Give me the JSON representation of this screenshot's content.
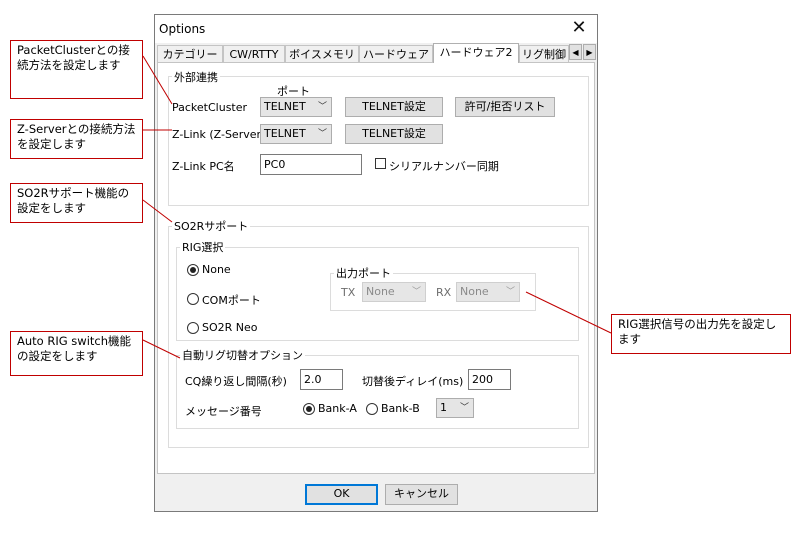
{
  "dialog": {
    "title": "Options",
    "close_glyph": "✕",
    "tabs": [
      "カテゴリー",
      "CW/RTTY",
      "ボイスメモリ",
      "ハードウェア",
      "ハードウェア2",
      "リグ制御"
    ],
    "active_tab": "ハードウェア2",
    "tab_scroll_left": "◀",
    "tab_scroll_right": "▶"
  },
  "external": {
    "group_label": "外部連携",
    "port_header": "ポート",
    "packet_label": "PacketCluster",
    "packet_port": "TELNET",
    "packet_telnet_btn": "TELNET設定",
    "packet_list_btn": "許可/拒否リスト",
    "zlink_label": "Z-Link (Z-Server",
    "zlink_port": "TELNET",
    "zlink_telnet_btn": "TELNET設定",
    "pcname_label": "Z-Link PC名",
    "pcname_value": "PC0",
    "serial_sync_label": "シリアルナンバー同期"
  },
  "so2r": {
    "group_label": "SO2Rサポート",
    "rig_group_label": "RIG選択",
    "options": [
      "None",
      "COMポート",
      "SO2R Neo"
    ],
    "output_port_label": "出力ポート",
    "tx_label": "TX",
    "tx_value": "None",
    "rx_label": "RX",
    "rx_value": "None"
  },
  "autorig": {
    "group_label": "自動リグ切替オプション",
    "cq_interval_label": "CQ繰り返し間隔(秒)",
    "cq_interval_value": "2.0",
    "delay_label": "切替後ディレイ(ms)",
    "delay_value": "200",
    "message_label": "メッセージ番号",
    "bank_a": "Bank-A",
    "bank_b": "Bank-B",
    "message_number": "1"
  },
  "footer": {
    "ok": "OK",
    "cancel": "キャンセル"
  },
  "annotations": {
    "packet": "PacketClusterとの接続方法を設定します",
    "zserver": "Z-Serverとの接続方法を設定します",
    "so2r": "SO2Rサポート機能の設定をします",
    "autorig": "Auto RIG switch機能の設定をします",
    "rigsignal": "RIG選択信号の出力先を設定します"
  },
  "colors": {
    "annotation_border": "#c00000",
    "default_button_border": "#0078d7"
  }
}
